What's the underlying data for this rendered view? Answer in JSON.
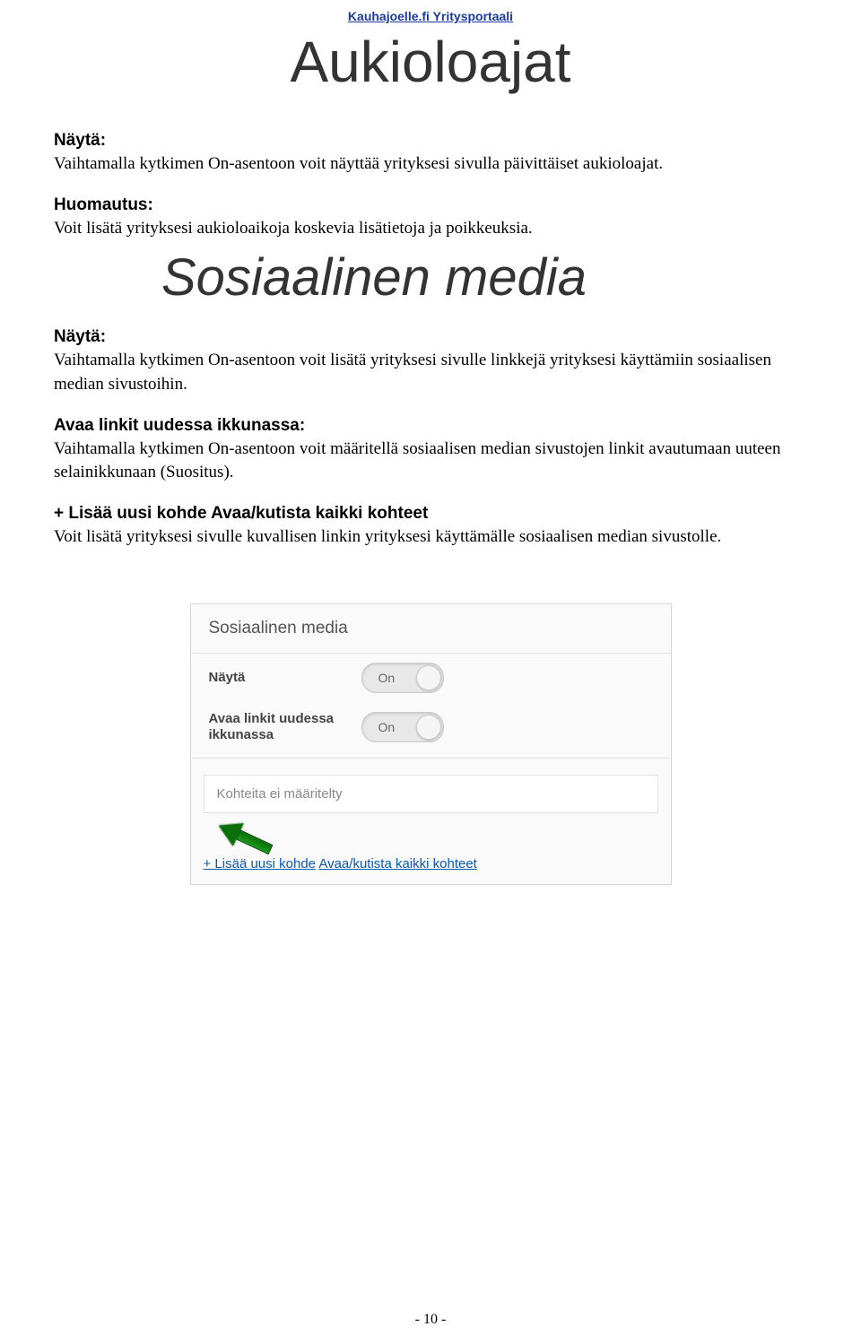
{
  "header": {
    "site_link": "Kauhajoelle.fi Yritysportaali",
    "title": "Aukioloajat"
  },
  "section1": {
    "label": "Näytä:",
    "text": "Vaihtamalla kytkimen On-asentoon voit näyttää yrityksesi sivulla päivittäiset aukioloajat."
  },
  "section2": {
    "label": "Huomautus:",
    "text": "Voit lisätä yrityksesi aukioloaikoja koskevia lisätietoja ja poikkeuksia."
  },
  "heading2": "Sosiaalinen media",
  "section3": {
    "label": "Näytä:",
    "text": "Vaihtamalla kytkimen On-asentoon voit lisätä yrityksesi sivulle linkkejä yrityksesi käyttämiin sosiaalisen median sivustoihin."
  },
  "section4": {
    "label": "Avaa linkit uudessa ikkunassa:",
    "text": "Vaihtamalla kytkimen On-asentoon voit määritellä sosiaalisen median sivustojen linkit avautumaan uuteen selainikkunaan (Suositus)."
  },
  "section5": {
    "label": "+ Lisää uusi kohde Avaa/kutista kaikki kohteet",
    "text": "Voit lisätä yrityksesi sivulle kuvallisen linkin yrityksesi käyttämälle sosiaalisen median sivustolle."
  },
  "panel": {
    "title": "Sosiaalinen media",
    "row1_label": "Näytä",
    "row2_label": "Avaa linkit uudessa ikkunassa",
    "toggle_text": "On",
    "subbox": "Kohteita ei määritelty",
    "link1": "+ Lisää uusi kohde",
    "link2": "Avaa/kutista kaikki kohteet"
  },
  "page_number": "- 10 -"
}
